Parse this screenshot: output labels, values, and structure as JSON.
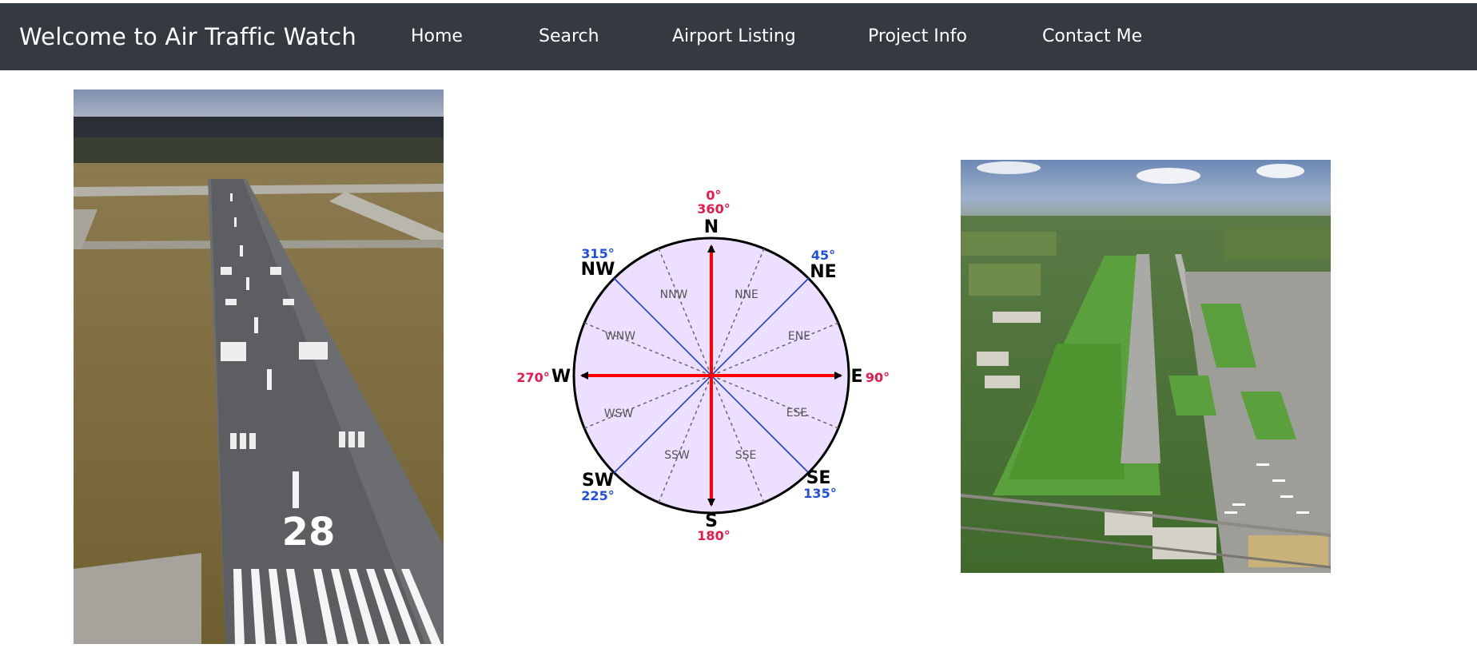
{
  "navbar": {
    "brand": "Welcome to Air Traffic Watch",
    "links": [
      {
        "label": "Home"
      },
      {
        "label": "Search"
      },
      {
        "label": "Airport Listing"
      },
      {
        "label": "Project Info"
      },
      {
        "label": "Contact Me"
      }
    ],
    "background": "#343a40"
  },
  "images": {
    "runway": {
      "runway_number": "28"
    },
    "compass": {
      "cardinals": {
        "north": {
          "letter": "N",
          "deg1": "0°",
          "deg2": "360°"
        },
        "east": {
          "letter": "E",
          "deg": "90°"
        },
        "south": {
          "letter": "S",
          "deg": "180°"
        },
        "west": {
          "letter": "W",
          "deg": "270°"
        }
      },
      "intercardinals": {
        "ne": {
          "letter": "NE",
          "deg": "45°"
        },
        "se": {
          "letter": "SE",
          "deg": "135°"
        },
        "sw": {
          "letter": "SW",
          "deg": "225°"
        },
        "nw": {
          "letter": "NW",
          "deg": "315°"
        }
      },
      "minor": {
        "nne": "NNE",
        "ene": "ENE",
        "ese": "ESE",
        "sse": "SSE",
        "ssw": "SSW",
        "wsw": "WSW",
        "wnw": "WNW",
        "nnw": "NNW"
      },
      "colors": {
        "cardinal_axis": "#ff0000",
        "diagonal": "#1f3fd6",
        "fill": "#ecdfff",
        "red_text": "#e8194b",
        "blue_text": "#1f4fe0"
      }
    }
  }
}
